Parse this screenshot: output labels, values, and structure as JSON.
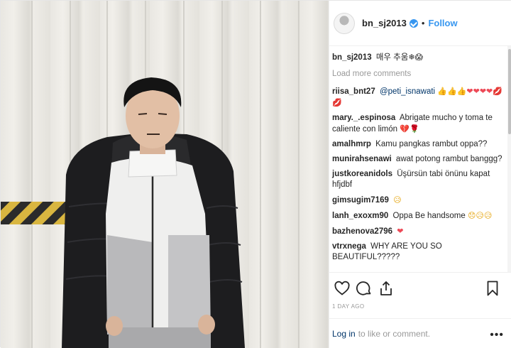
{
  "post": {
    "username": "bn_sj2013",
    "follow_label": "Follow",
    "separator": "•",
    "caption_user": "bn_sj2013",
    "caption_text": "매우 추움",
    "caption_emoji": "❄😱"
  },
  "comments_section": {
    "load_more": "Load more comments",
    "items": [
      {
        "user": "riisa_bnt27",
        "mention": "@peti_isnawati",
        "text": "",
        "emoji": "👍👍👍❤❤❤❤💋💋"
      },
      {
        "user": "mary._.espinosa",
        "mention": "",
        "text": "Abrigate mucho y toma te caliente con limón",
        "emoji": "💔🌹"
      },
      {
        "user": "amalhmrp",
        "mention": "",
        "text": "Kamu pangkas rambut oppa??",
        "emoji": ""
      },
      {
        "user": "munirahsenawi",
        "mention": "",
        "text": "awat potong rambut banggg?",
        "emoji": ""
      },
      {
        "user": "justkoreanidols",
        "mention": "",
        "text": "Üşürsün tabi önünu kapat hfjdbf",
        "emoji": ""
      },
      {
        "user": "gimsugim7169",
        "mention": "",
        "text": "",
        "emoji": "😥"
      },
      {
        "user": "lanh_exoxm90",
        "mention": "",
        "text": "Oppa Be handsome",
        "emoji": "😞😥😥"
      },
      {
        "user": "bazhenova2796",
        "mention": "",
        "text": "",
        "emoji": "❤"
      },
      {
        "user": "vtrxnega",
        "mention": "",
        "text": "WHY ARE YOU SO BEAUTIFUL?????",
        "emoji": ""
      }
    ]
  },
  "footer": {
    "time": "1 DAY AGO",
    "login_link": "Log in",
    "login_text": "to like or comment.",
    "more": "•••"
  },
  "icons": {
    "avatar": "profile-avatar",
    "verified": "verified-badge-icon",
    "like": "heart-outline-icon",
    "comment": "comment-bubble-icon",
    "share": "share-upload-icon",
    "save": "bookmark-icon",
    "more": "more-options-icon"
  },
  "colors": {
    "accent": "#3897f0",
    "mention": "#003569",
    "muted": "#999999",
    "text": "#262626"
  }
}
